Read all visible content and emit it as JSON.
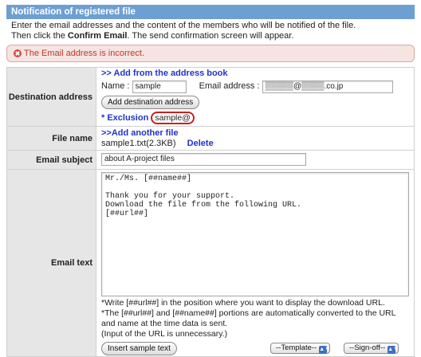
{
  "title": "Notification of registered file",
  "intro": {
    "line1": "Enter the email addresses and the content of the members who will be notified of the file.",
    "line2_a": "Then click the ",
    "line2_b": "Confirm Email",
    "line2_c": ". The send confirmation screen will appear."
  },
  "error": {
    "message": "The Email address is incorrect.",
    "icon": "error-icon",
    "color": "#c0392b"
  },
  "destination": {
    "label": "Destination address",
    "add_from_book": ">> Add from the address book",
    "name_label": "Name :",
    "name_value": "sample",
    "email_label": "Email address :",
    "email_value": "▒▒▒▒▒@▒▒▒▒.co.jp",
    "add_button": "Add destination address",
    "exclusion_label": "* Exclusion",
    "exclusion_value": "sample@"
  },
  "file": {
    "label": "File name",
    "add_another": ">>Add another file",
    "file_value": "sample1.txt(2.3KB)",
    "delete": "Delete"
  },
  "subject": {
    "label": "Email subject",
    "value": "about A-project files"
  },
  "email_text": {
    "label": "Email text",
    "body": "Mr./Ms. [##name##]\n\nThank you for your support.\nDownload the file from the following URL.\n[##url##]",
    "note1": "*Write [##url##] in the position where you want to display the download URL.",
    "note2": "*The [##url##] and [##name##] portions are automatically converted to the URL",
    "note3": "and name at the time data is sent.",
    "note4": "(Input of the URL is unnecessary.)",
    "insert_button": "Insert sample text",
    "template_select": "--Template--",
    "signoff_select": "--Sign-off--"
  },
  "colors": {
    "accent": "#6e9fd3",
    "link": "#2233cc",
    "exclusion_highlight": "#cc1f1f"
  }
}
